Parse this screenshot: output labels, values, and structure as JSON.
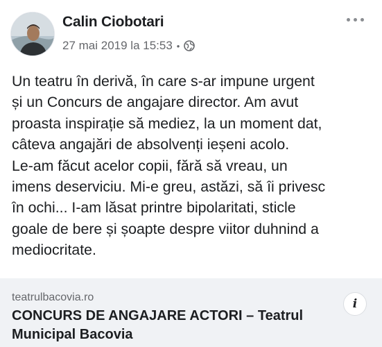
{
  "post": {
    "author": "Calin Ciobotari",
    "timestamp": "27 mai 2019 la 15:53",
    "separator": "•",
    "privacy_icon": "globe-icon",
    "more_icon": "more-options-icon",
    "text": "Un teatru în derivă, în care s-ar impune urgent\nși un Concurs de angajare director. Am avut\nproasta inspirație să mediez, la un moment dat,\ncâteva angajări de absolvenți ieșeni acolo.\nLe-am făcut acelor copii, fără să vreau, un\nimens deserviciu. Mi-e greu, astăzi, să îi privesc\nîn ochi... I-am lăsat printre bipolaritati, sticle\ngoale  de bere și șoapte despre viitor duhnind a\nmediocritate."
  },
  "link_preview": {
    "domain": "teatrulbacovia.ro",
    "title": "CONCURS DE ANGAJARE ACTORI – Teatrul Municipal Bacovia",
    "info_label": "i"
  },
  "colors": {
    "text": "#1c1e21",
    "secondary": "#65676b",
    "card_bg": "#f0f2f5"
  }
}
